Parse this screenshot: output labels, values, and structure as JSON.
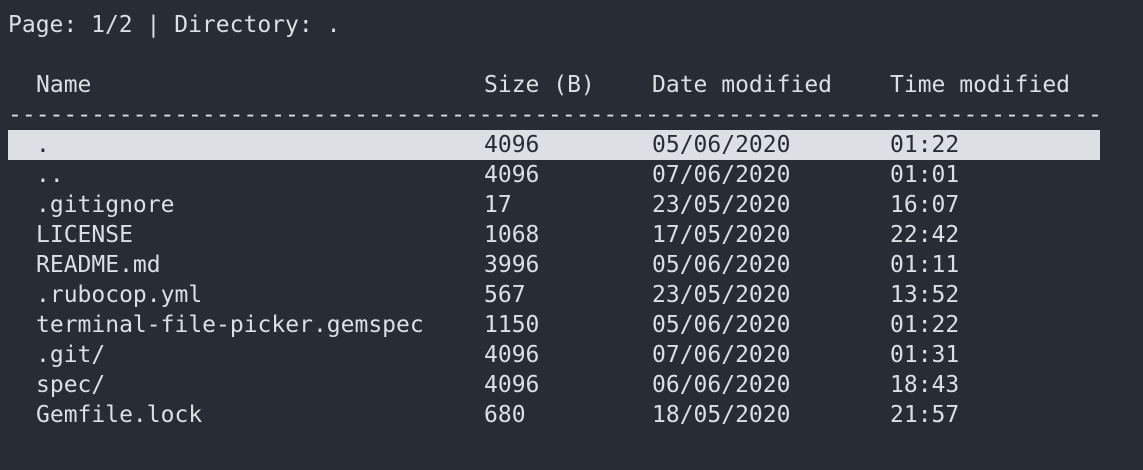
{
  "status": {
    "page_label": "Page:",
    "page_value": "1/2",
    "separator": "|",
    "directory_label": "Directory:",
    "directory_value": "."
  },
  "table": {
    "headers": {
      "name": "Name",
      "size": "Size (B)",
      "date": "Date modified",
      "time": "Time modified"
    },
    "divider": "-------------------------------------------------------------------------------",
    "selected_index": 0,
    "rows": [
      {
        "name": ".",
        "size": "4096",
        "date": "05/06/2020",
        "time": "01:22"
      },
      {
        "name": "..",
        "size": "4096",
        "date": "07/06/2020",
        "time": "01:01"
      },
      {
        "name": ".gitignore",
        "size": "17",
        "date": "23/05/2020",
        "time": "16:07"
      },
      {
        "name": "LICENSE",
        "size": "1068",
        "date": "17/05/2020",
        "time": "22:42"
      },
      {
        "name": "README.md",
        "size": "3996",
        "date": "05/06/2020",
        "time": "01:11"
      },
      {
        "name": ".rubocop.yml",
        "size": "567",
        "date": "23/05/2020",
        "time": "13:52"
      },
      {
        "name": "terminal-file-picker.gemspec",
        "size": "1150",
        "date": "05/06/2020",
        "time": "01:22"
      },
      {
        "name": ".git/",
        "size": "4096",
        "date": "07/06/2020",
        "time": "01:31"
      },
      {
        "name": "spec/",
        "size": "4096",
        "date": "06/06/2020",
        "time": "18:43"
      },
      {
        "name": "Gemfile.lock",
        "size": "680",
        "date": "18/05/2020",
        "time": "21:57"
      }
    ]
  },
  "colors": {
    "background": "#282c34",
    "foreground": "#dcdfe4",
    "selection_background": "#dcdfe4",
    "selection_foreground": "#282c34"
  }
}
